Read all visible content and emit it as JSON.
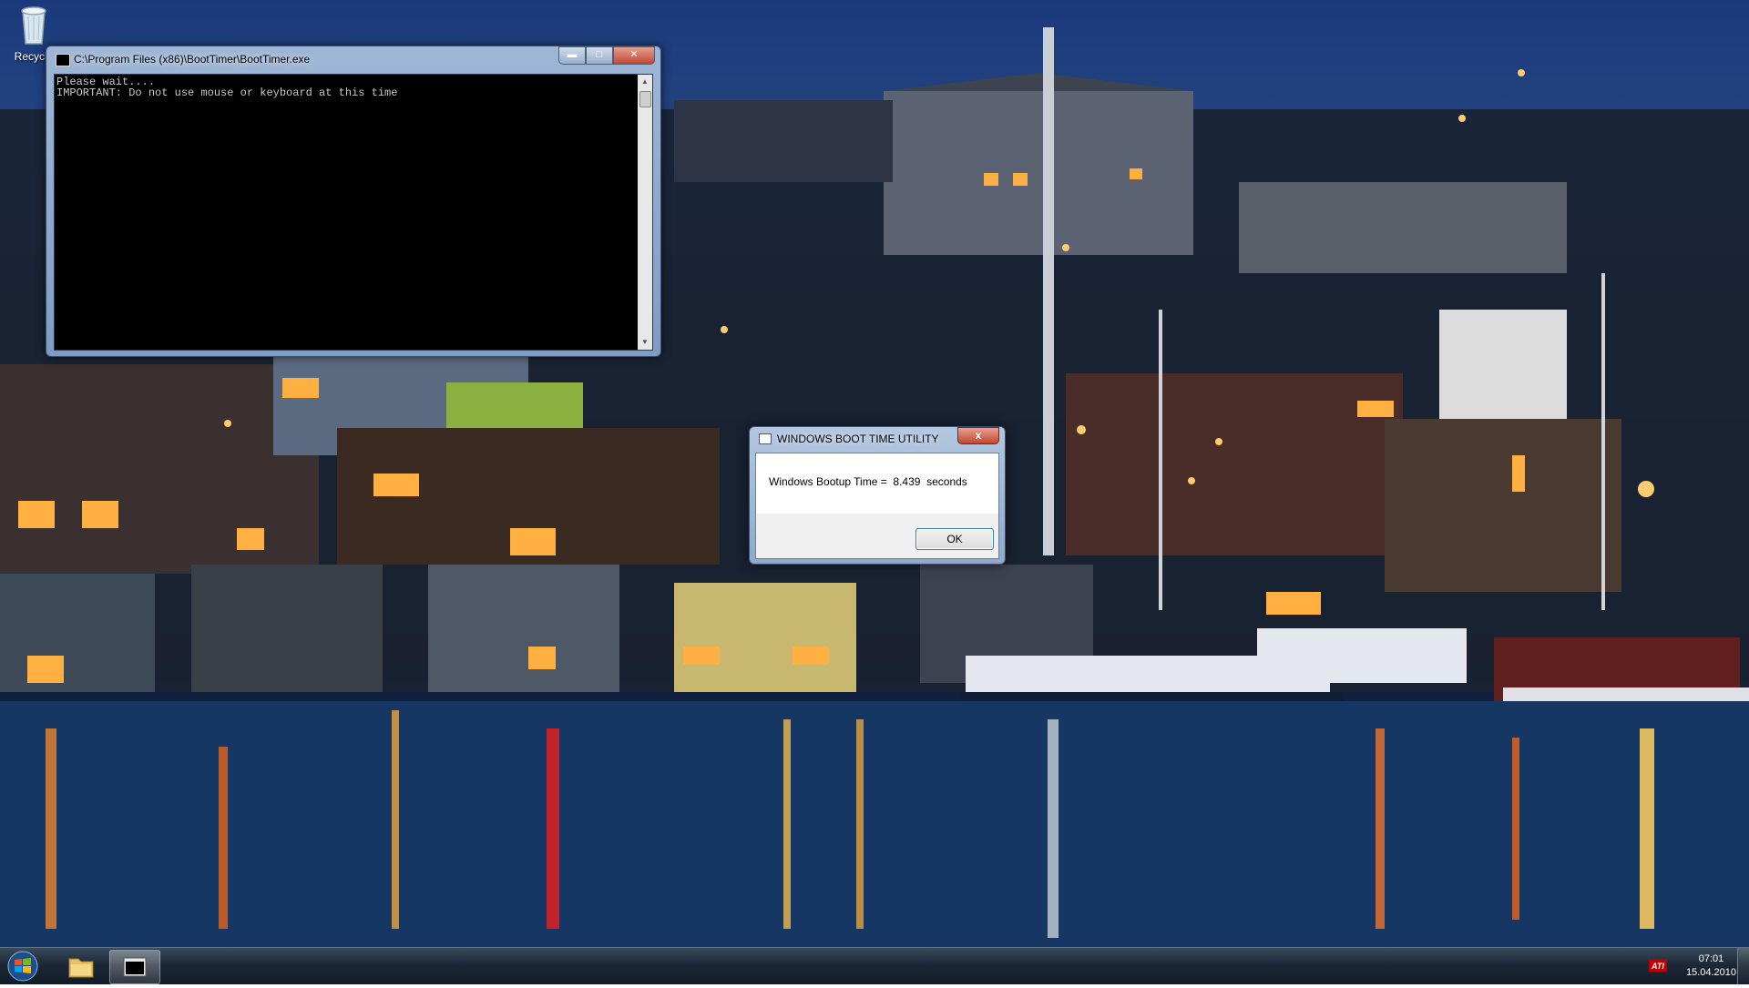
{
  "desktop": {
    "recycle_bin_label": "Recycle",
    "recycle_bin_icon": "recycle-bin-icon"
  },
  "console_window": {
    "title": "C:\\Program Files (x86)\\BootTimer\\BootTimer.exe",
    "output_lines": [
      "Please wait....",
      "IMPORTANT: Do not use mouse or keyboard at this time"
    ],
    "buttons": [
      "minimize",
      "maximize",
      "close"
    ]
  },
  "dialog": {
    "title": "WINDOWS BOOT TIME UTILITY",
    "message": "Windows Bootup Time =  8.439  seconds",
    "ok_label": "OK",
    "close_glyph": "x"
  },
  "taskbar": {
    "items": [
      {
        "name": "start-button",
        "icon": "windows-orb-icon"
      },
      {
        "name": "explorer",
        "icon": "folder-icon"
      },
      {
        "name": "boottimer-console",
        "icon": "console-window-icon",
        "active": true
      }
    ],
    "tray": {
      "icon": "ati-icon",
      "time": "07:01",
      "date": "15.04.2010"
    }
  }
}
